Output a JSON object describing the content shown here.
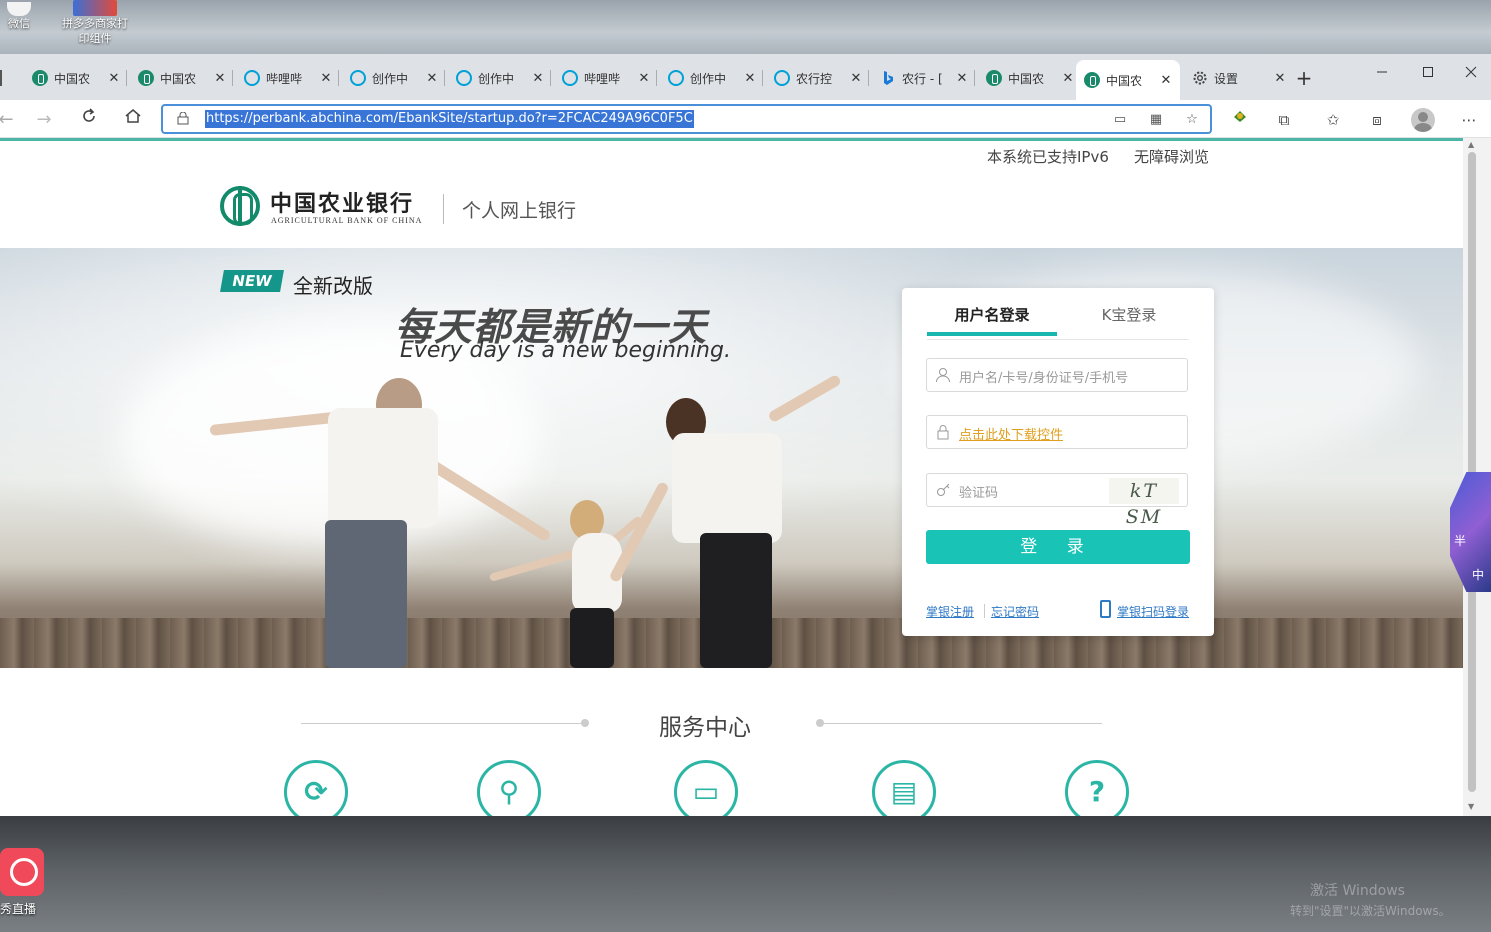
{
  "desktop": {
    "icons": [
      {
        "label": "微信"
      },
      {
        "label": "拼多多商家打印组件"
      }
    ],
    "bottom_app_label": "秀直播",
    "watermark_line1": "激活 Windows",
    "watermark_line2": "转到\"设置\"以激活Windows。"
  },
  "browser": {
    "tabs": [
      {
        "title": "中国农",
        "icon": "abc-bank-icon"
      },
      {
        "title": "中国农",
        "icon": "abc-bank-icon"
      },
      {
        "title": "哔哩哔",
        "icon": "bilibili-icon"
      },
      {
        "title": "创作中",
        "icon": "bilibili-icon"
      },
      {
        "title": "创作中",
        "icon": "bilibili-icon"
      },
      {
        "title": "哔哩哔",
        "icon": "bilibili-icon"
      },
      {
        "title": "创作中",
        "icon": "bilibili-icon"
      },
      {
        "title": "农行控",
        "icon": "bilibili-icon"
      },
      {
        "title": "农行 - [",
        "icon": "bing-icon"
      },
      {
        "title": "中国农",
        "icon": "abc-bank-icon"
      },
      {
        "title": "中国农",
        "icon": "abc-bank-icon",
        "active": true
      },
      {
        "title": "设置",
        "icon": "gear-icon"
      }
    ],
    "close_glyph": "✕",
    "new_tab_glyph": "+",
    "url": "https://perbank.abchina.com/EbankSite/startup.do?r=2FCAC249A96C0F5C"
  },
  "page": {
    "top_links": [
      "本系统已支持IPv6",
      "无障碍浏览"
    ],
    "bank_name_cn": "中国农业银行",
    "bank_name_en": "AGRICULTURAL BANK OF CHINA",
    "header_sub": "个人网上银行",
    "banner": {
      "new_badge": "NEW",
      "new_text": "全新改版",
      "slogan_cn": "每天都是新的一天",
      "slogan_en": "Every day is a new beginning."
    },
    "login": {
      "tab_username": "用户名登录",
      "tab_kbao": "K宝登录",
      "username_placeholder": "用户名/卡号/身份证号/手机号",
      "password_link": "点击此处下载控件",
      "captcha_placeholder": "验证码",
      "captcha_text": "kT SM",
      "submit_label": "登 录",
      "register_link": "掌银注册",
      "forgot_link": "忘记密码",
      "scan_link": "掌银扫码登录"
    },
    "service": {
      "title": "服务中心",
      "icons": [
        "refresh-icon",
        "key-icon",
        "card-icon",
        "document-icon",
        "help-icon"
      ]
    }
  },
  "colors": {
    "brand_green": "#138a6a",
    "accent_teal": "#19c3b6",
    "link_blue": "#2e79c6",
    "link_orange": "#e0a01f"
  }
}
